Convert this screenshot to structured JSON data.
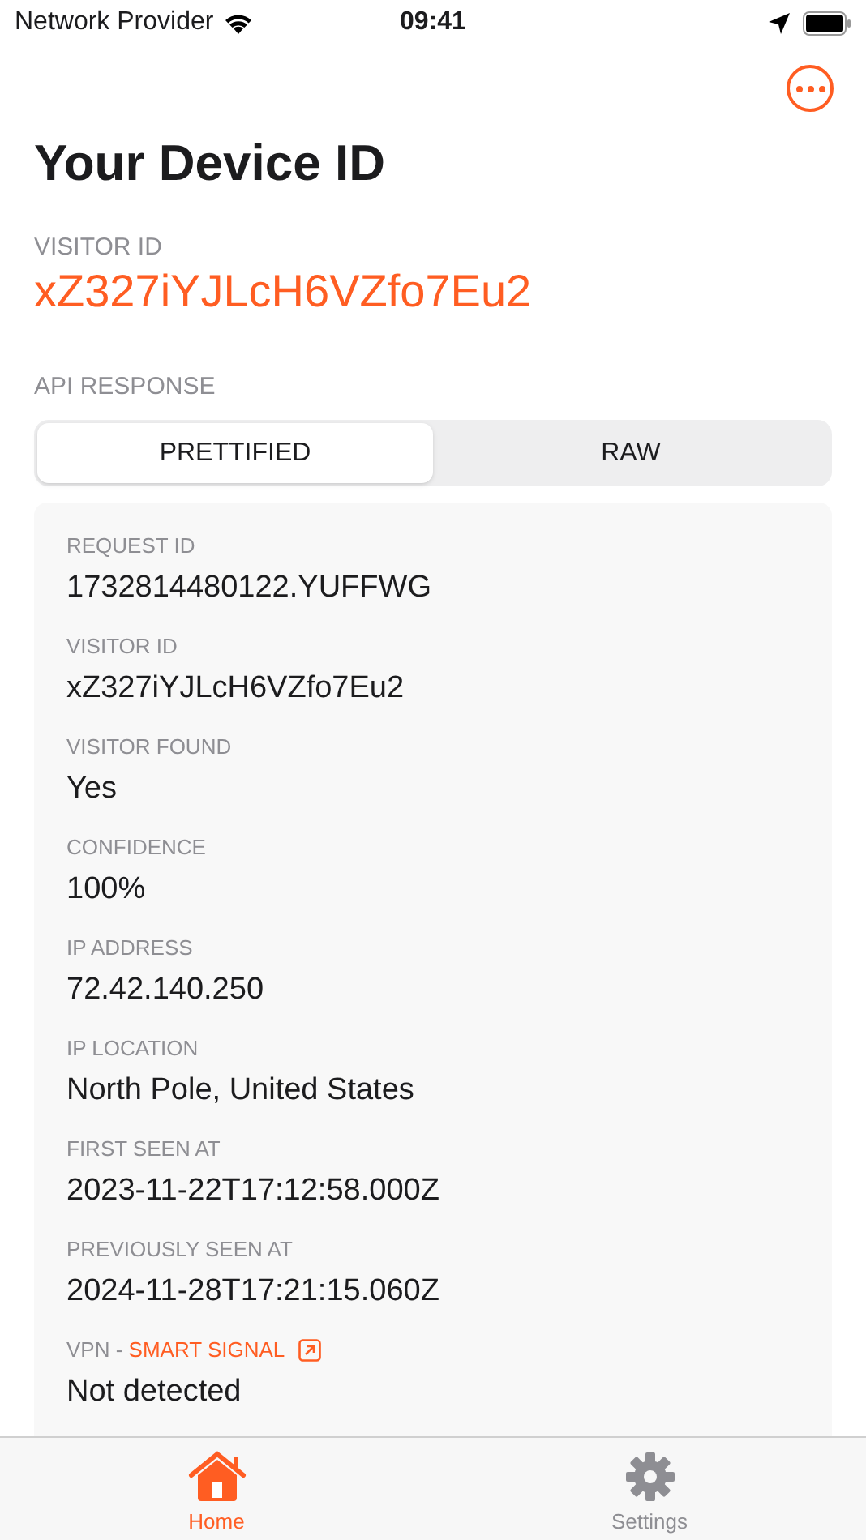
{
  "status_bar": {
    "carrier": "Network Provider",
    "time": "09:41"
  },
  "title": "Your Device ID",
  "visitor": {
    "label": "VISITOR ID",
    "value": "xZ327iYJLcH6VZfo7Eu2"
  },
  "api_response": {
    "label": "API RESPONSE",
    "segments": [
      {
        "label": "PRETTIFIED",
        "selected": true
      },
      {
        "label": "RAW",
        "selected": false
      }
    ],
    "fields": [
      {
        "label": "REQUEST ID",
        "value": "1732814480122.YUFFWG"
      },
      {
        "label": "VISITOR ID",
        "value": "xZ327iYJLcH6VZfo7Eu2"
      },
      {
        "label": "VISITOR FOUND",
        "value": "Yes"
      },
      {
        "label": "CONFIDENCE",
        "value": "100%"
      },
      {
        "label": "IP ADDRESS",
        "value": "72.42.140.250"
      },
      {
        "label": "IP LOCATION",
        "value": "North Pole, United States"
      },
      {
        "label": "FIRST SEEN AT",
        "value": "2023-11-22T17:12:58.000Z"
      },
      {
        "label": "PREVIOUSLY SEEN AT",
        "value": "2024-11-28T17:21:15.060Z"
      },
      {
        "label": "VPN - ",
        "link": "SMART SIGNAL",
        "value": "Not detected"
      }
    ]
  },
  "tab_bar": [
    {
      "label": "Home",
      "selected": true
    },
    {
      "label": "Settings",
      "selected": false
    }
  ]
}
